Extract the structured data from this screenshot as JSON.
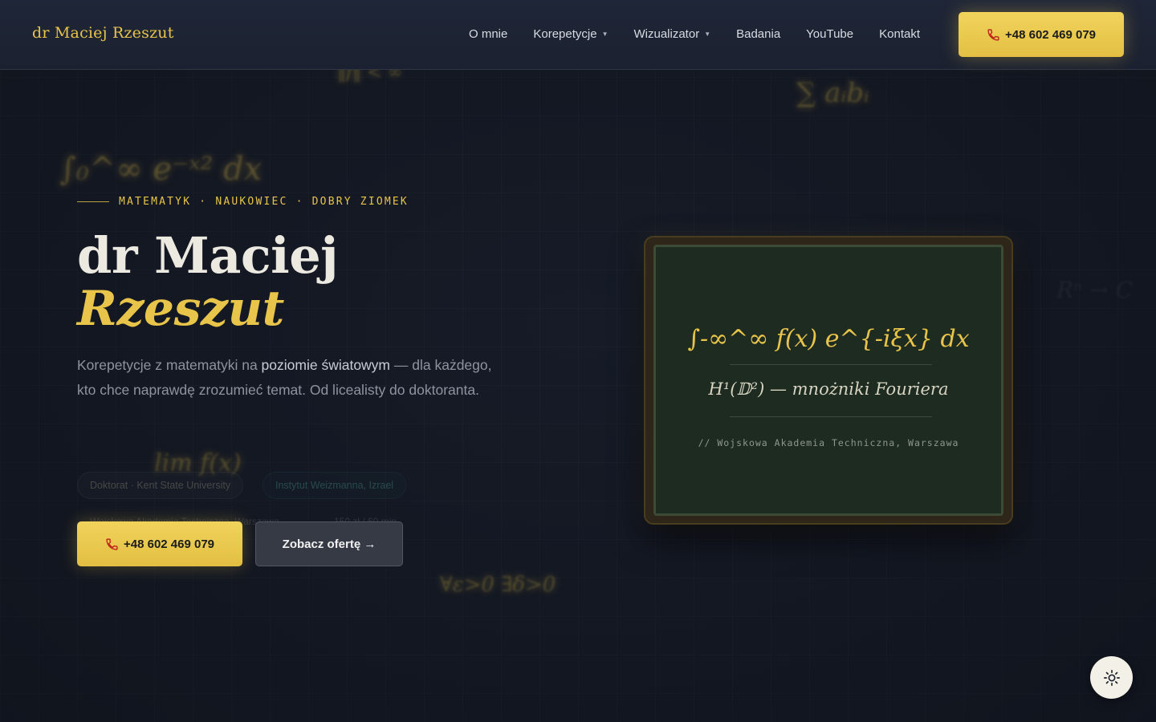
{
  "header": {
    "brand": "dr Maciej Rzeszut",
    "nav": [
      {
        "label": "O mnie",
        "dropdown": false
      },
      {
        "label": "Korepetycje",
        "dropdown": true
      },
      {
        "label": "Wizualizator",
        "dropdown": true
      },
      {
        "label": "Badania",
        "dropdown": false
      },
      {
        "label": "YouTube",
        "dropdown": false
      },
      {
        "label": "Kontakt",
        "dropdown": false
      }
    ],
    "phone": "+48 602 469 079",
    "phone_icon": "phone-icon"
  },
  "hero": {
    "kicker": "MATEMATYK · NAUKOWIEC · DOBRY ZIOMEK",
    "title_line1": "dr Maciej",
    "title_line2": "Rzeszut",
    "lede_part1": "Korepetycje z matematyki na ",
    "lede_bold": "poziomie światowym",
    "lede_part2": " — dla każdego, kto chce naprawdę zrozumieć temat. Od licealisty do doktoranta.",
    "chips": [
      "Doktorat · Kent State University",
      "Instytut Weizmanna, Izrael"
    ],
    "faint_items": [
      "Wojskowa Akademia Techniczna, Warszawa",
      "150 zł / 60 min"
    ],
    "cta_phone": "+48 602 469 079",
    "cta_offer": "Zobacz ofertę →"
  },
  "board": {
    "formula": "∫-∞^∞ f(x) e^{-iξx} dx",
    "subtitle": "H¹(𝔻²) — mnożniki Fouriera",
    "note": "// Wojskowa Akademia Techniczna, Warszawa"
  },
  "floating_formulas": [
    "∫₀^∞ e⁻ˣ² dx",
    "∑ aᵢbᵢ",
    "‖f‖ < ∞",
    "Rⁿ → C",
    "lim f(x)",
    "∀ε>0 ∃δ>0"
  ],
  "theme_toggle_icon": "sun-icon",
  "colors": {
    "accent": "#e8c44a",
    "background": "#161b27",
    "chalkboard": "#1d2b21"
  }
}
